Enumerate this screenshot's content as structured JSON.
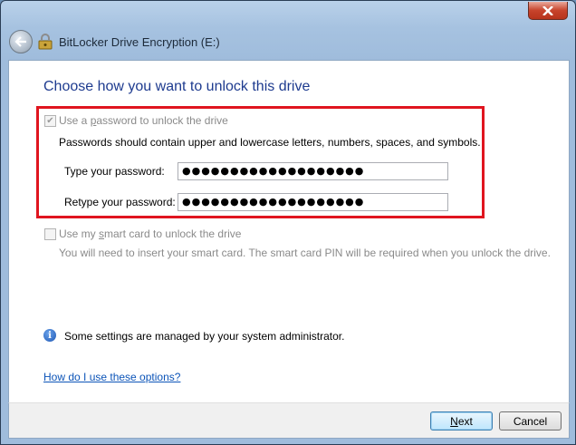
{
  "window": {
    "title": "BitLocker Drive Encryption (E:)"
  },
  "main": {
    "heading": "Choose how you want to unlock this drive",
    "password_option": {
      "label_pre": "Use a ",
      "label_u": "p",
      "label_post": "assword to unlock the drive",
      "checked": true,
      "hint": "Passwords should contain upper and lowercase letters, numbers, spaces, and symbols.",
      "type_label": "Type your password:",
      "type_value": "●●●●●●●●●●●●●●●●●●●",
      "retype_label": "Retype your password:",
      "retype_value": "●●●●●●●●●●●●●●●●●●●"
    },
    "smartcard_option": {
      "label_pre": "Use my ",
      "label_u": "s",
      "label_post": "mart card to unlock the drive",
      "checked": false,
      "hint": "You will need to insert your smart card. The smart card PIN will be required when you unlock the drive."
    },
    "info_text": "Some settings are managed by your system administrator.",
    "help_link": "How do I use these options?"
  },
  "footer": {
    "next_label": "Next",
    "next_u": "N",
    "next_rest": "ext",
    "cancel_label": "Cancel"
  },
  "colors": {
    "heading": "#1e3b8f",
    "highlight_box": "#e0151f",
    "link": "#0c54b8"
  }
}
